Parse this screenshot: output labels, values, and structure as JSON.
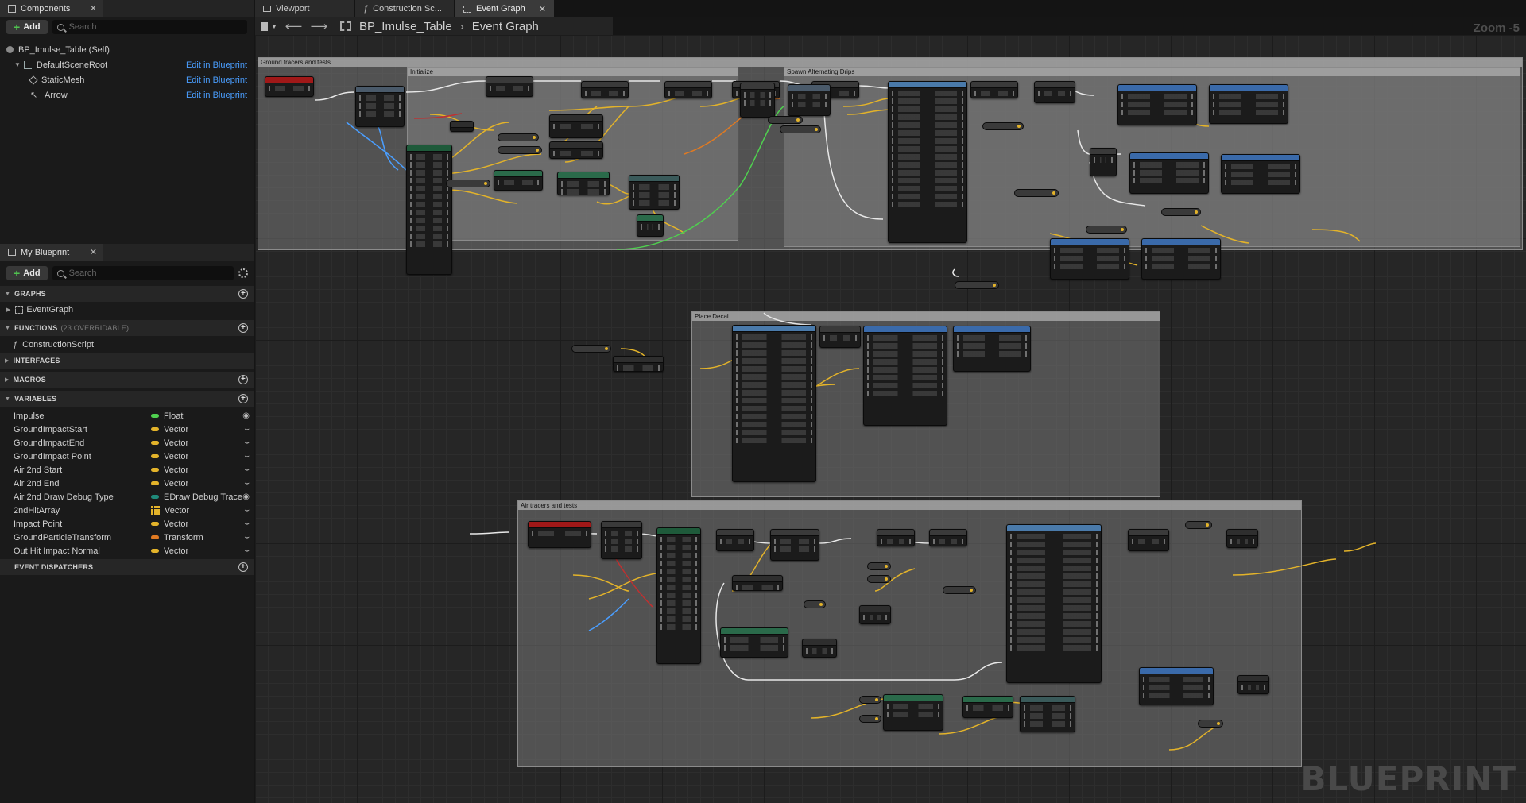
{
  "components_panel": {
    "tab_label": "Components",
    "add_label": "Add",
    "search_placeholder": "Search",
    "self_label": "BP_Imulse_Table (Self)",
    "items": [
      {
        "label": "DefaultSceneRoot",
        "edit": "Edit in Blueprint"
      },
      {
        "label": "StaticMesh",
        "edit": "Edit in Blueprint"
      },
      {
        "label": "Arrow",
        "edit": "Edit in Blueprint"
      }
    ]
  },
  "my_blueprint": {
    "tab_label": "My Blueprint",
    "add_label": "Add",
    "search_placeholder": "Search",
    "sections": {
      "graphs": "GRAPHS",
      "functions": "FUNCTIONS",
      "functions_hint": "(23 OVERRIDABLE)",
      "interfaces": "INTERFACES",
      "macros": "MACROS",
      "variables": "VARIABLES",
      "event_dispatchers": "EVENT DISPATCHERS"
    },
    "graph_items": [
      "EventGraph"
    ],
    "function_items": [
      "ConstructionScript"
    ],
    "variables": [
      {
        "name": "Impulse",
        "type": "Float",
        "color": "#4fd04f",
        "kind": "pill",
        "vis": "eye"
      },
      {
        "name": "GroundImpactStart",
        "type": "Vector",
        "color": "#e3b32a",
        "kind": "pill",
        "vis": "closed"
      },
      {
        "name": "GroundImpactEnd",
        "type": "Vector",
        "color": "#e3b32a",
        "kind": "pill",
        "vis": "closed"
      },
      {
        "name": "GroundImpact Point",
        "type": "Vector",
        "color": "#e3b32a",
        "kind": "pill",
        "vis": "closed"
      },
      {
        "name": "Air 2nd Start",
        "type": "Vector",
        "color": "#e3b32a",
        "kind": "pill",
        "vis": "closed"
      },
      {
        "name": "Air 2nd End",
        "type": "Vector",
        "color": "#e3b32a",
        "kind": "pill",
        "vis": "closed"
      },
      {
        "name": "Air 2nd Draw Debug Type",
        "type": "EDraw Debug Trace",
        "color": "#1f8a7a",
        "kind": "pill",
        "vis": "eye"
      },
      {
        "name": "2ndHitArray",
        "type": "Vector",
        "color": "#e3b32a",
        "kind": "array",
        "vis": "closed"
      },
      {
        "name": "Impact Point",
        "type": "Vector",
        "color": "#e3b32a",
        "kind": "pill",
        "vis": "closed"
      },
      {
        "name": "GroundParticleTransform",
        "type": "Transform",
        "color": "#e07a22",
        "kind": "pill",
        "vis": "closed"
      },
      {
        "name": "Out Hit Impact Normal",
        "type": "Vector",
        "color": "#e3b32a",
        "kind": "pill",
        "vis": "closed"
      }
    ]
  },
  "doc_tabs": [
    {
      "label": "Viewport"
    },
    {
      "label": "Construction Sc..."
    },
    {
      "label": "Event Graph"
    }
  ],
  "breadcrumb": {
    "blueprint": "BP_Imulse_Table",
    "graph": "Event Graph"
  },
  "zoom_label": "Zoom -5",
  "watermark": "BLUEPRINT",
  "comments": [
    {
      "title": "Ground tracers and tests"
    },
    {
      "title": "Initialize"
    },
    {
      "title": "Spawn Alternating Drips"
    },
    {
      "title": "Place Decal"
    },
    {
      "title": "Air tracers and tests"
    }
  ]
}
